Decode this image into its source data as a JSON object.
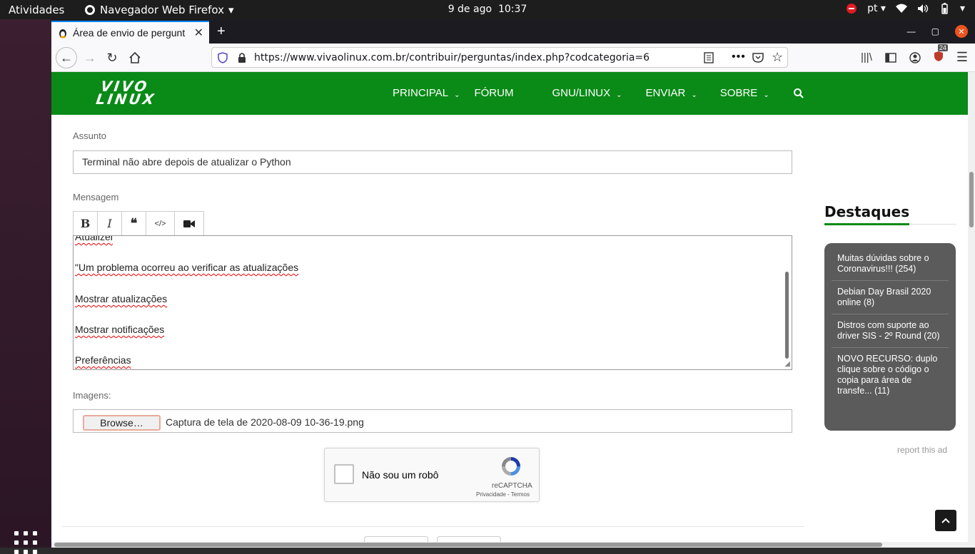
{
  "topbar": {
    "activities": "Atividades",
    "app_name": "Navegador Web Firefox",
    "date": "9 de ago",
    "time": "10:37",
    "lang": "pt"
  },
  "browser": {
    "tab_title": "Área de envio de pergunt",
    "url": "https://www.vivaolinux.com.br/contribuir/perguntas/index.php?codcategoria=6",
    "addon_badge": "24"
  },
  "site": {
    "logo_line1": "VIVO",
    "logo_line2": "LINUX",
    "menu": [
      {
        "label": "PRINCIPAL"
      },
      {
        "label": "FÓRUM"
      },
      {
        "label": "GNU/LINUX"
      },
      {
        "label": "ENVIAR"
      },
      {
        "label": "SOBRE"
      }
    ]
  },
  "form": {
    "subject_label": "Assunto",
    "subject_value": "Terminal não abre depois de atualizar o Python",
    "message_label": "Mensagem",
    "toolbar": {
      "bold": "B",
      "italic": "I",
      "quote": "❝",
      "code": "</>"
    },
    "message_lines": [
      "Atualizei",
      "\"Um problema ocorreu ao verificar as atualizações",
      "Mostrar atualizações",
      "Mostrar notificações",
      "Preferências"
    ],
    "images_label": "Imagens:",
    "browse_label": "Browse…",
    "file_name": "Captura de tela de 2020-08-09 10-36-19.png",
    "captcha_text": "Não sou um robô",
    "captcha_brand": "reCAPTCHA",
    "captcha_links": "Privacidade - Termos"
  },
  "sidebar": {
    "title": "Destaques",
    "items": [
      {
        "text": "Muitas dúvidas sobre o Coronavirus!!! (254)"
      },
      {
        "text": "Debian Day Brasil 2020 online (8)"
      },
      {
        "text": "Distros com suporte ao driver SIS - 2º Round (20)"
      },
      {
        "text": "NOVO RECURSO: duplo clique sobre o código o copia para área de transfe... (11)"
      }
    ],
    "report_ad": "report this ad"
  },
  "colors": {
    "site_green": "#0a8a17",
    "accent_orange": "#e95420"
  }
}
